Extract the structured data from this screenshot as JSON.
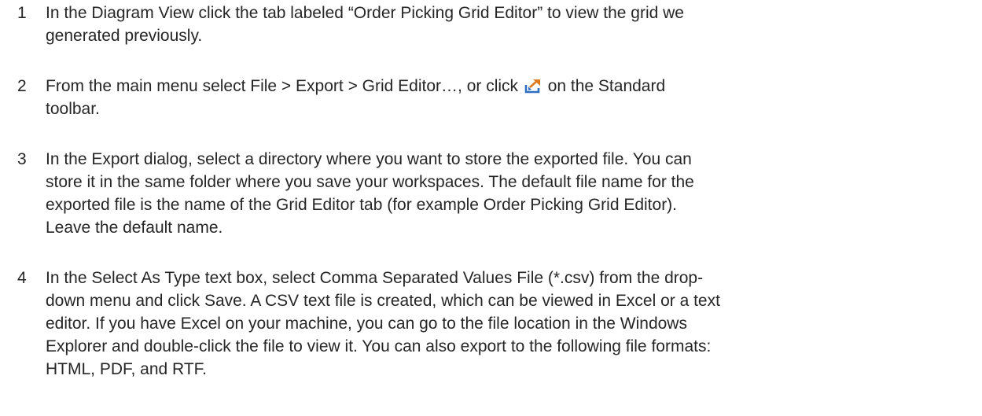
{
  "steps": [
    {
      "number": "1",
      "lines": [
        "In the Diagram View click the tab labeled “Order Picking Grid Editor” to view the grid we",
        "generated previously."
      ]
    },
    {
      "number": "2",
      "before_icon": "From the main menu select File > Export > Grid Editor…, or click ",
      "icon": "export-icon",
      "after_icon": " on the Standard",
      "line2": "toolbar."
    },
    {
      "number": "3",
      "lines": [
        "In the Export dialog, select a directory where you want to store the exported file. You can",
        "store it in the same folder where you save your workspaces. The default file name for the",
        "exported file is the name of the Grid Editor tab (for example Order Picking Grid Editor).",
        "Leave the default name."
      ]
    },
    {
      "number": "4",
      "lines": [
        "In the Select As Type text box, select Comma Separated Values File (*.csv) from the drop-",
        "down menu and click Save. A CSV text file is created, which can be viewed in Excel or a text",
        "editor. If you have Excel on your machine, you can go to the file location in the Windows",
        "Explorer and double-click the file to view it. You can also export to the following file formats:",
        "HTML, PDF, and RTF."
      ]
    }
  ],
  "colors": {
    "text": "#262626",
    "icon_blue": "#2f6fc2",
    "icon_orange": "#e07a1f"
  }
}
